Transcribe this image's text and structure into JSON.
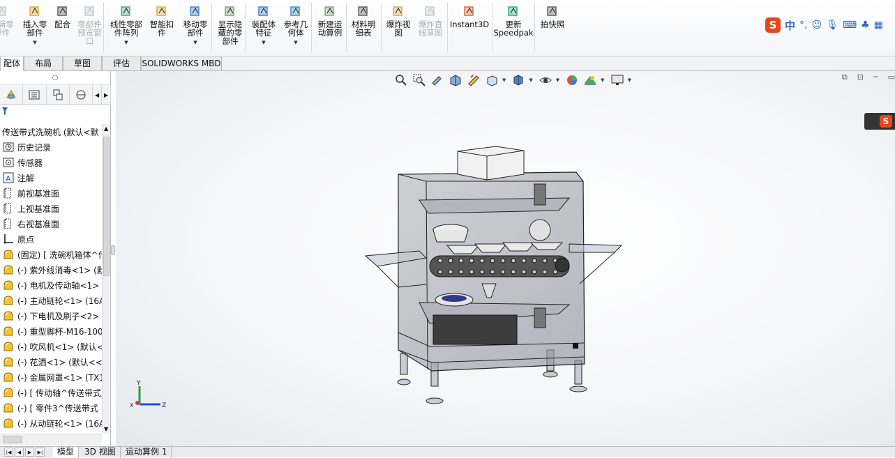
{
  "ribbon": {
    "buttons": [
      {
        "label": "编辑零\n部件",
        "enabled": false,
        "dropdown": false
      },
      {
        "label": "插入零\n部件",
        "enabled": true,
        "dropdown": true
      },
      {
        "label": "配合",
        "enabled": true,
        "dropdown": false
      },
      {
        "label": "零部件\n预览窗\n口",
        "enabled": false,
        "dropdown": false
      },
      {
        "label": "线性零部\n件阵列",
        "enabled": true,
        "dropdown": true
      },
      {
        "label": "智能扣\n件",
        "enabled": true,
        "dropdown": false
      },
      {
        "label": "移动零\n部件",
        "enabled": true,
        "dropdown": true
      },
      {
        "label": "显示隐\n藏的零\n部件",
        "enabled": true,
        "dropdown": false
      },
      {
        "label": "装配体\n特征",
        "enabled": true,
        "dropdown": true
      },
      {
        "label": "参考几\n何体",
        "enabled": true,
        "dropdown": true
      },
      {
        "label": "新建运\n动算例",
        "enabled": true,
        "dropdown": false
      },
      {
        "label": "材料明\n细表",
        "enabled": true,
        "dropdown": false
      },
      {
        "label": "爆炸视\n图",
        "enabled": true,
        "dropdown": false
      },
      {
        "label": "爆炸直\n线草图",
        "enabled": false,
        "dropdown": false
      },
      {
        "label": "Instant3D",
        "enabled": true,
        "dropdown": false
      },
      {
        "label": "更新\nSpeedpak",
        "enabled": true,
        "dropdown": false
      },
      {
        "label": "拍快照",
        "enabled": true,
        "dropdown": false
      }
    ]
  },
  "ime": {
    "lang": "中",
    "punct": "°,"
  },
  "tabs": [
    "配体",
    "布局",
    "草图",
    "评估",
    "SOLIDWORKS MBD"
  ],
  "active_tab": 0,
  "tree": {
    "root": "传送带式洗碗机 (默认<默",
    "items": [
      {
        "label": "历史记录",
        "icon": "history-icon"
      },
      {
        "label": "传感器",
        "icon": "sensor-icon"
      },
      {
        "label": "注解",
        "icon": "annotation-icon"
      },
      {
        "label": "前视基准面",
        "icon": "plane-icon"
      },
      {
        "label": "上视基准面",
        "icon": "plane-icon"
      },
      {
        "label": "右视基准面",
        "icon": "plane-icon"
      },
      {
        "label": "原点",
        "icon": "origin-icon"
      },
      {
        "label": "(固定) [ 洗碗机箱体^传",
        "icon": "subassembly-icon"
      },
      {
        "label": "(-) 紫外线消毒<1> (默",
        "icon": "subassembly-icon"
      },
      {
        "label": "(-) 电机及传动轴<1>",
        "icon": "subassembly-icon"
      },
      {
        "label": "(-) 主动链轮<1> (16A",
        "icon": "subassembly-icon"
      },
      {
        "label": "(-) 下电机及刷子<2>",
        "icon": "subassembly-icon"
      },
      {
        "label": "(-) 重型脚杯-M16-100",
        "icon": "subassembly-icon"
      },
      {
        "label": "(-) 吹风机<1> (默认<",
        "icon": "subassembly-icon"
      },
      {
        "label": "(-) 花洒<1> (默认<<",
        "icon": "subassembly-icon"
      },
      {
        "label": "(-) 金属网罩<1> (TX1",
        "icon": "subassembly-icon"
      },
      {
        "label": "(-) [ 传动轴^传送带式",
        "icon": "subassembly-icon"
      },
      {
        "label": "(-) [ 零件3^传送带式",
        "icon": "subassembly-icon"
      },
      {
        "label": "(-) 从动链轮<1> (16A",
        "icon": "subassembly-icon"
      }
    ]
  },
  "triad": {
    "x": "X",
    "y": "Y",
    "z": "Z"
  },
  "bottom_tabs": [
    "模型",
    "3D 视图",
    "运动算例 1"
  ],
  "bottom_active": 0,
  "colors": {
    "accent": "#2b66c3",
    "sogou": "#e8471c"
  }
}
